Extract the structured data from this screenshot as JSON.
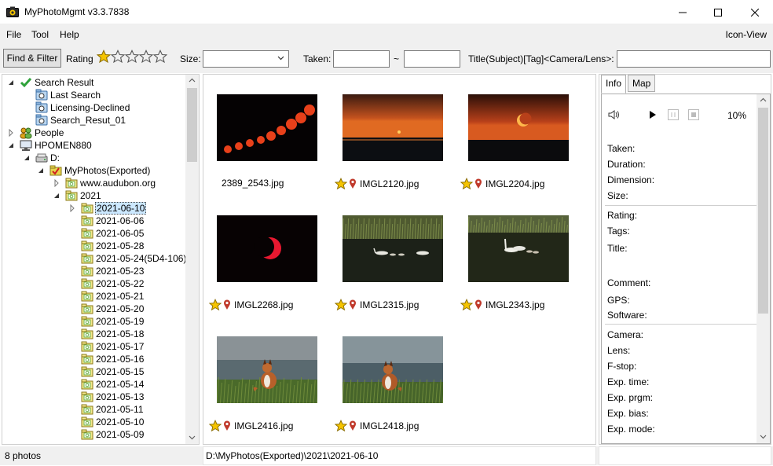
{
  "window": {
    "title": "MyPhotoMgmt v3.3.7838",
    "controls": {
      "minimize": "minimize",
      "maximize": "maximize",
      "close": "close"
    }
  },
  "menu": {
    "items": [
      "File",
      "Tool",
      "Help"
    ],
    "view_mode": "Icon-View"
  },
  "toolbar": {
    "find_button": "Find & Filter",
    "rating_label": "Rating",
    "rating_value": 1,
    "rating_max": 5,
    "size_label": "Size:",
    "size_value": "",
    "taken_label": "Taken:",
    "taken_from": "",
    "taken_sep": "~",
    "taken_to": "",
    "title_label": "Title(Subject)[Tag]<Camera/Lens>:",
    "title_value": ""
  },
  "tree": {
    "rows": [
      {
        "label": "Search Result",
        "icon": "check-icon",
        "arrow": "expanded"
      },
      {
        "label": "Last Search",
        "icon": "saved-search-icon",
        "arrow": "none"
      },
      {
        "label": "Licensing-Declined",
        "icon": "saved-search-icon",
        "arrow": "none"
      },
      {
        "label": "Search_Resut_01",
        "icon": "saved-search-icon",
        "arrow": "none"
      },
      {
        "label": "People",
        "icon": "people-icon",
        "arrow": "collapsed"
      },
      {
        "label": "HPOMEN880",
        "icon": "computer-icon",
        "arrow": "expanded"
      },
      {
        "label": "D:",
        "icon": "drive-icon",
        "arrow": "expanded"
      },
      {
        "label": "MyPhotos(Exported)",
        "icon": "checked-folder-icon",
        "arrow": "expanded"
      },
      {
        "label": "www.audubon.org",
        "icon": "photo-folder-icon",
        "arrow": "collapsed"
      },
      {
        "label": "2021",
        "icon": "photo-folder-icon",
        "arrow": "expanded"
      },
      {
        "label": "2021-06-10",
        "icon": "photo-folder-icon",
        "arrow": "collapsed",
        "selected": true
      },
      {
        "label": "2021-06-06",
        "icon": "photo-folder-icon",
        "arrow": "none"
      },
      {
        "label": "2021-06-05",
        "icon": "photo-folder-icon",
        "arrow": "none"
      },
      {
        "label": "2021-05-28",
        "icon": "photo-folder-icon",
        "arrow": "none"
      },
      {
        "label": "2021-05-24(5D4-106)",
        "icon": "photo-folder-icon",
        "arrow": "none"
      },
      {
        "label": "2021-05-23",
        "icon": "photo-folder-icon",
        "arrow": "none"
      },
      {
        "label": "2021-05-22",
        "icon": "photo-folder-icon",
        "arrow": "none"
      },
      {
        "label": "2021-05-21",
        "icon": "photo-folder-icon",
        "arrow": "none"
      },
      {
        "label": "2021-05-20",
        "icon": "photo-folder-icon",
        "arrow": "none"
      },
      {
        "label": "2021-05-19",
        "icon": "photo-folder-icon",
        "arrow": "none"
      },
      {
        "label": "2021-05-18",
        "icon": "photo-folder-icon",
        "arrow": "none"
      },
      {
        "label": "2021-05-17",
        "icon": "photo-folder-icon",
        "arrow": "none"
      },
      {
        "label": "2021-05-16",
        "icon": "photo-folder-icon",
        "arrow": "none"
      },
      {
        "label": "2021-05-15",
        "icon": "photo-folder-icon",
        "arrow": "none"
      },
      {
        "label": "2021-05-14",
        "icon": "photo-folder-icon",
        "arrow": "none"
      },
      {
        "label": "2021-05-13",
        "icon": "photo-folder-icon",
        "arrow": "none"
      },
      {
        "label": "2021-05-11",
        "icon": "photo-folder-icon",
        "arrow": "none"
      },
      {
        "label": "2021-05-10",
        "icon": "photo-folder-icon",
        "arrow": "none"
      },
      {
        "label": "2021-05-09",
        "icon": "photo-folder-icon",
        "arrow": "none"
      }
    ]
  },
  "photos": [
    {
      "name": "2389_2543.jpg",
      "scene": "eclipse-sequence",
      "rated": false,
      "geotag": false
    },
    {
      "name": "IMGL2120.jpg",
      "scene": "sunset-sea",
      "rated": true,
      "geotag": true
    },
    {
      "name": "IMGL2204.jpg",
      "scene": "eclipse-crescent",
      "rated": true,
      "geotag": true
    },
    {
      "name": "IMGL2268.jpg",
      "scene": "red-crescent",
      "rated": true,
      "geotag": true
    },
    {
      "name": "IMGL2315.jpg",
      "scene": "swans-reeds",
      "rated": true,
      "geotag": true
    },
    {
      "name": "IMGL2343.jpg",
      "scene": "swans-family",
      "rated": true,
      "geotag": true
    },
    {
      "name": "IMGL2416.jpg",
      "scene": "fox-grass",
      "rated": true,
      "geotag": true
    },
    {
      "name": "IMGL2418.jpg",
      "scene": "fox-grass-2",
      "rated": true,
      "geotag": true
    }
  ],
  "info": {
    "tabs": [
      "Info",
      "Map"
    ],
    "active_tab": "Info",
    "zoom": "10%",
    "fields": [
      "Taken:",
      "Duration:",
      "Dimension:",
      "Size:",
      "Rating:",
      "Tags:",
      "Title:",
      "Comment:",
      "GPS:",
      "Software:",
      "Camera:",
      "Lens:",
      "F-stop:",
      "Exp. time:",
      "Exp. prgm:",
      "Exp. bias:",
      "Exp. mode:"
    ]
  },
  "status": {
    "count": "8 photos",
    "path": "D:\\MyPhotos(Exported)\\2021\\2021-06-10",
    "right": ""
  },
  "colors": {
    "star": "#f5c400",
    "pin": "#c0392b",
    "folder": "#e8d44d",
    "selection": "#cce8ff",
    "check": "#2fa23a"
  }
}
